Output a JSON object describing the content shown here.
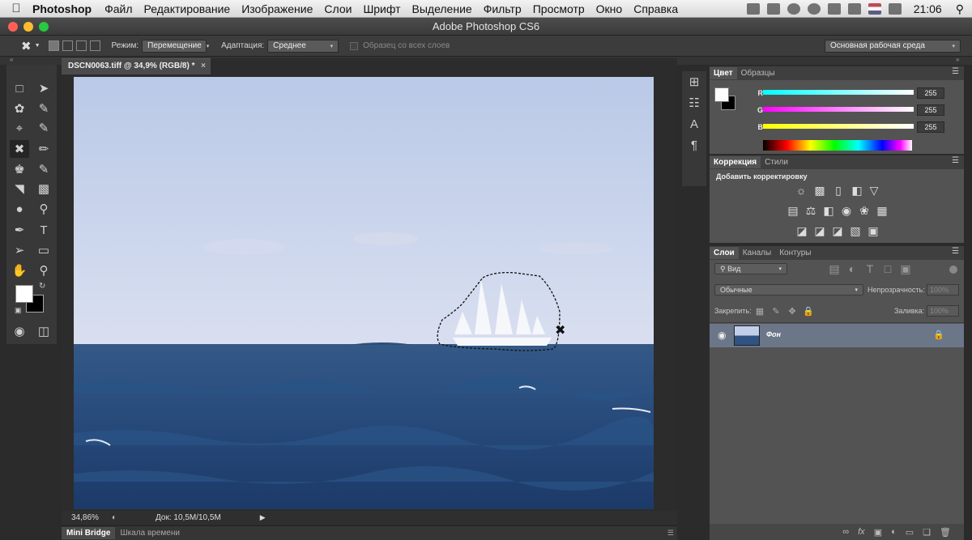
{
  "os_menubar": {
    "app": "Photoshop",
    "items": [
      "Файл",
      "Редактирование",
      "Изображение",
      "Слои",
      "Шрифт",
      "Выделение",
      "Фильтр",
      "Просмотр",
      "Окно",
      "Справка"
    ],
    "clock": "21:06",
    "status_icons": [
      "photoshop-cs-icon",
      "display-icon",
      "time-machine-icon",
      "sync-icon",
      "bluetooth-icon",
      "wifi-icon",
      "flag-us-icon",
      "volume-icon",
      "search-icon"
    ]
  },
  "window": {
    "title": "Adobe Photoshop CS6",
    "light_colors": [
      "#ff5f57",
      "#febc2e",
      "#28c840"
    ]
  },
  "options_bar": {
    "mode_label": "Режим:",
    "mode_value": "Перемещение",
    "adaptation_label": "Адаптация:",
    "adaptation_value": "Среднее",
    "sample_all_layers": "Образец со всех слоев",
    "workspace": "Основная рабочая среда"
  },
  "document": {
    "tab_title": "DSCN0063.tiff @ 34,9% (RGB/8) *",
    "zoom": "34,86%",
    "doc_info": "Док: 10,5M/10,5M"
  },
  "bottom_tabs": [
    "Mini Bridge",
    "Шкала времени"
  ],
  "color_panel": {
    "tabs": [
      "Цвет",
      "Образцы"
    ],
    "channels": [
      {
        "label": "R",
        "value": "255",
        "gradient": "#00ffff"
      },
      {
        "label": "G",
        "value": "255",
        "gradient": "#ff00ff"
      },
      {
        "label": "B",
        "value": "255",
        "gradient": "#ffff00"
      }
    ]
  },
  "adjustments_panel": {
    "tabs": [
      "Коррекция",
      "Стили"
    ],
    "heading": "Добавить корректировку",
    "row1": [
      "brightness-icon",
      "levels-icon",
      "curves-icon",
      "exposure-icon",
      "vibrance-icon"
    ],
    "row2": [
      "hue-saturation-icon",
      "color-balance-icon",
      "black-white-icon",
      "photo-filter-icon",
      "channel-mixer-icon",
      "color-lookup-icon"
    ],
    "row3": [
      "invert-icon",
      "posterize-icon",
      "threshold-icon",
      "gradient-map-icon",
      "selective-color-icon"
    ]
  },
  "layers_panel": {
    "tabs": [
      "Слои",
      "Каналы",
      "Контуры"
    ],
    "filter_kind": "Вид",
    "blend_mode": "Обычные",
    "opacity_label": "Непрозрачность:",
    "opacity_value": "100%",
    "lock_label": "Закрепить:",
    "fill_label": "Заливка:",
    "fill_value": "100%",
    "layers": [
      {
        "name": "Фон",
        "visible": true,
        "locked": true
      }
    ]
  }
}
